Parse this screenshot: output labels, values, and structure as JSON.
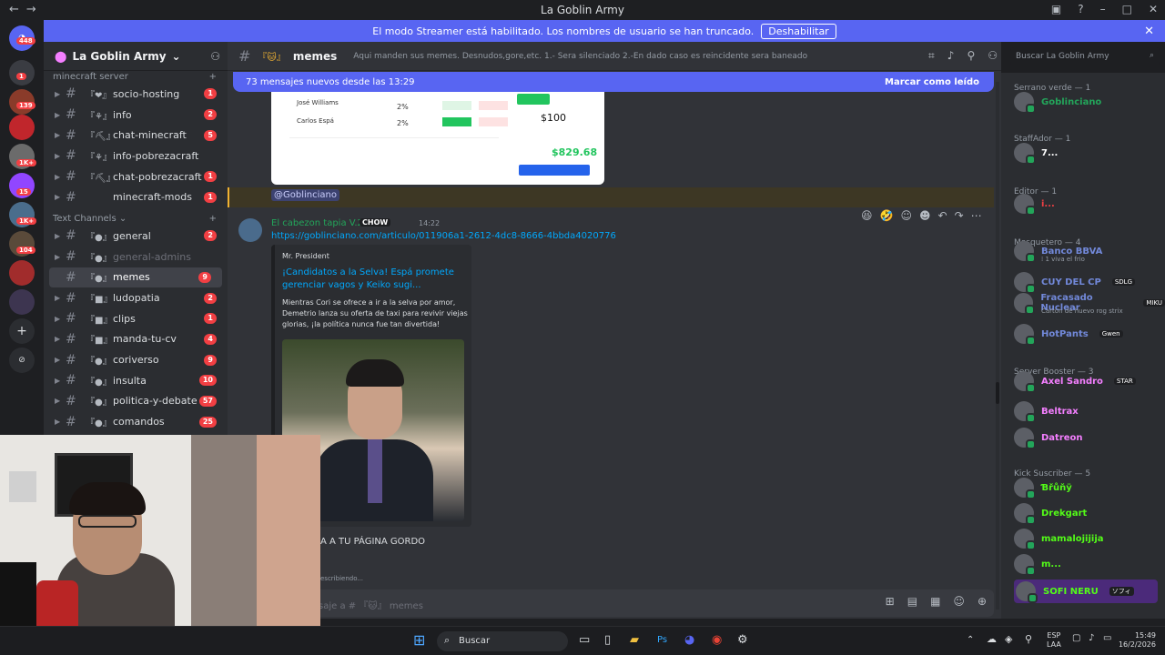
{
  "window": {
    "title": "La Goblin Army"
  },
  "banner": {
    "text": "El modo Streamer está habilitado. Los nombres de usuario se han truncado.",
    "button": "Deshabilitar"
  },
  "guild_badges": [
    "448",
    "1",
    "139",
    "1K+",
    "15",
    "1K+",
    "104"
  ],
  "server": {
    "name": "La Goblin Army"
  },
  "categories": {
    "minecraft": "minecraft server",
    "text": "Text Channels"
  },
  "channels": [
    {
      "emoji": "『❤』",
      "name": "socio-hosting",
      "badge": "1"
    },
    {
      "emoji": "『⚘』",
      "name": "info",
      "badge": "2"
    },
    {
      "emoji": "『⛏』",
      "name": "chat-minecraft",
      "badge": "5"
    },
    {
      "emoji": "『⚘』",
      "name": "info-pobrezacraft",
      "badge": ""
    },
    {
      "emoji": "『⛏』",
      "name": "chat-pobrezacraft",
      "badge": "1"
    },
    {
      "emoji": "",
      "name": "minecraft-mods",
      "badge": "1"
    },
    {
      "emoji": "『●』",
      "name": "general",
      "badge": "2"
    },
    {
      "emoji": "『●』",
      "name": "general-admins",
      "badge": ""
    },
    {
      "emoji": "『●』",
      "name": "memes",
      "badge": "9"
    },
    {
      "emoji": "『■』",
      "name": "ludopatia",
      "badge": "2"
    },
    {
      "emoji": "『■』",
      "name": "clips",
      "badge": "1"
    },
    {
      "emoji": "『■』",
      "name": "manda-tu-cv",
      "badge": "4"
    },
    {
      "emoji": "『●』",
      "name": "coriverso",
      "badge": "9"
    },
    {
      "emoji": "『●』",
      "name": "insulta",
      "badge": "10"
    },
    {
      "emoji": "『●』",
      "name": "politica-y-debate",
      "badge": "57"
    },
    {
      "emoji": "『●』",
      "name": "comandos",
      "badge": "25"
    }
  ],
  "chat": {
    "channel": "memes",
    "topic": "Aqui manden sus memes. Desnudos,gore,etc. 1.- Sera silenciado 2.-En dado caso es reincidente sera baneado",
    "newbar": "73 mensajes nuevos desde las 13:29",
    "mark_read": "Marcar como leído",
    "mention": "@Goblinciano",
    "author": "El cabezon tapia V.2",
    "author_tag": "CHOW",
    "time": "14:22",
    "link": "https://goblinciano.com/articulo/011906a1-2612-4dc8-8666-4bbda4020776",
    "embed_site": "Mr. President",
    "embed_title": "¡Candidatos a la Selva! Espá promete gerenciar vagos y Keiko sugi...",
    "embed_desc": "Mientras Cori se ofrece a ir a la selva por amor, Demetrio lanza su oferta de taxi para revivir viejas glorias, ¡la política nunca fue tan divertida!",
    "reply_text": "A A TU PÁGINA GORDO",
    "typing": "escribiendo...",
    "composer_placeholder": "saje a # 『🐱』 memes",
    "img_amount": "$100",
    "img_total": "$829.68",
    "img_pct1": "2%",
    "img_pct2": "2%"
  },
  "search": {
    "placeholder": "Buscar La Goblin Army"
  },
  "members": {
    "groups": [
      {
        "label": "Serrano verde — 1",
        "names": [
          {
            "n": "Goblinciano",
            "c": "#23a55a"
          }
        ]
      },
      {
        "label": "StaffAdor — 1",
        "names": [
          {
            "n": "7...",
            "c": "#ffffff"
          }
        ]
      },
      {
        "label": "Editor — 1",
        "names": [
          {
            "n": "i...",
            "c": "#f23f43"
          }
        ]
      },
      {
        "label": "Mosquetero — 4",
        "names": [
          {
            "n": "Banco BBVA",
            "c": "#7289da",
            "sub": "⁞ 1 viva el frio"
          },
          {
            "n": "CUY DEL CP",
            "c": "#7289da",
            "tag": "SDLG"
          },
          {
            "n": "Fracasado Nuclear",
            "c": "#7289da",
            "tag": "MIKU",
            "sub": "Carton de huevo rog strix"
          },
          {
            "n": "HotPants",
            "c": "#7289da",
            "tag": "Gwen"
          }
        ]
      },
      {
        "label": "Server Booster — 3",
        "names": [
          {
            "n": "Axel Sandro",
            "c": "#f47fff",
            "tag": "STAR"
          },
          {
            "n": "Beltrax",
            "c": "#f47fff"
          },
          {
            "n": "Datreon",
            "c": "#f47fff"
          }
        ]
      },
      {
        "label": "Kick Suscriber — 5",
        "names": [
          {
            "n": "Ɓřůňÿ",
            "c": "#53fc18"
          },
          {
            "n": "Drekgart",
            "c": "#53fc18"
          },
          {
            "n": "mamalojijija",
            "c": "#53fc18"
          },
          {
            "n": "m...",
            "c": "#53fc18"
          },
          {
            "n": "SOFI NERU",
            "c": "#53fc18",
            "tag": "ソフィ"
          }
        ]
      }
    ]
  },
  "taskbar": {
    "search": "Buscar",
    "lang": "ESP",
    "lang2": "LAA",
    "time": "15:49",
    "date": "16/2/2026"
  }
}
